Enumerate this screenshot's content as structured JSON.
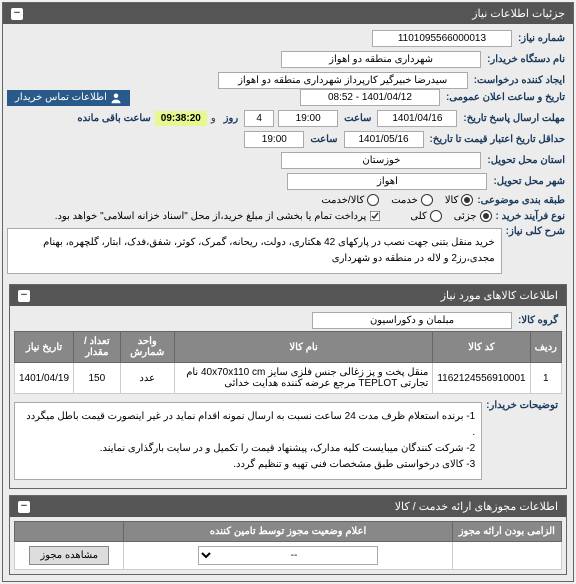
{
  "panels": {
    "main_title": "جزئیات اطلاعات نیاز",
    "items_title": "اطلاعات کالاهای مورد نیاز",
    "permit_title": "اطلاعات مجوزهای ارائه خدمت / کالا"
  },
  "labels": {
    "need_no": "شماره نیاز:",
    "buyer_org": "نام دستگاه خریدار:",
    "requester": "ایجاد کننده درخواست:",
    "announce_date": "تاریخ و ساعت اعلان عمومی:",
    "deadline": "مهلت ارسال پاسخ تاریخ:",
    "min_valid": "حداقل تاریخ اعتبار قیمت تا تاریخ:",
    "province": "استان محل تحویل:",
    "city": "شهر محل تحویل:",
    "category": "طبقه بندی موضوعی:",
    "buy_process": "نوع فرآیند خرید :",
    "contact_btn": "اطلاعات تماس خریدار",
    "hour": "ساعت",
    "day": "روز",
    "remaining": "ساعت باقی مانده",
    "payment_note": "پرداخت تمام یا بخشی از مبلغ خرید،از محل \"اسناد خزانه اسلامی\" خواهد بود.",
    "need_title": "شرح کلی نیاز:",
    "group": "گروه کالا:",
    "buyer_notes": "توضیحات خریدار:",
    "permit_required": "الزامی بودن ارائه مجوز",
    "permit_status": "اعلام وضعیت مجوز توسط تامین کننده",
    "view_permit": "مشاهده مجوز"
  },
  "values": {
    "need_no": "1101095566000013",
    "buyer_org": "شهرداری منطقه دو اهواز",
    "requester": "سیدرضا خبیرگیر کارپرداز  شهرداری منطقه دو اهواز",
    "announce_date": "1401/04/12 - 08:52",
    "deadline_date": "1401/04/16",
    "deadline_time": "19:00",
    "deadline_days": "4",
    "countdown": "09:38:20",
    "min_valid_date": "1401/05/16",
    "min_valid_time": "19:00",
    "province": "خوزستان",
    "city": "اهواز",
    "need_title_text": "خرید منقل بتنی جهت نصب در پارکهای 42 هکتاری، دولت، ریحانه، گمرک، کوثر، شفق،فدک، ابتار، گلچهره، بهنام مجدی،رز2 و لاله در منطقه دو شهرداری",
    "group": "مبلمان و دکوراسیون",
    "buyer_notes_text": "1- برنده استعلام ظرف مدت 24 ساعت نسبت به ارسال نمونه اقدام نماید در غیر اینصورت قیمت باطل میگردد .\n2- شرکت کنندگان میبایست کلیه مدارک، پیشنهاد قیمت را تکمیل و در سایت بارگذاری نمایند.\n3- کالای درخواستی طبق مشخصات فنی تهیه و تنظیم گردد.",
    "permit_select": "--"
  },
  "radios": {
    "category": {
      "goods": "کالا",
      "service": "خدمت",
      "both": "کالا/خدمت",
      "selected": "goods"
    },
    "buy_process": {
      "partial": "جزئی",
      "total": "کلی",
      "selected": "partial"
    }
  },
  "table": {
    "headers": {
      "row": "ردیف",
      "code": "کد کالا",
      "name": "نام کالا",
      "unit": "واحد شمارش",
      "qty": "تعداد / مقدار",
      "date": "تاریخ نیاز"
    },
    "rows": [
      {
        "row": "1",
        "code": "1162124556910001",
        "name": "منقل پخت و پز زغالی جنس فلزی سایز 40x70x110 cm نام تجارتی TEPLOT مرجع عرضه کننده هدایت خدائی",
        "unit": "عدد",
        "qty": "150",
        "date": "1401/04/19"
      }
    ]
  }
}
